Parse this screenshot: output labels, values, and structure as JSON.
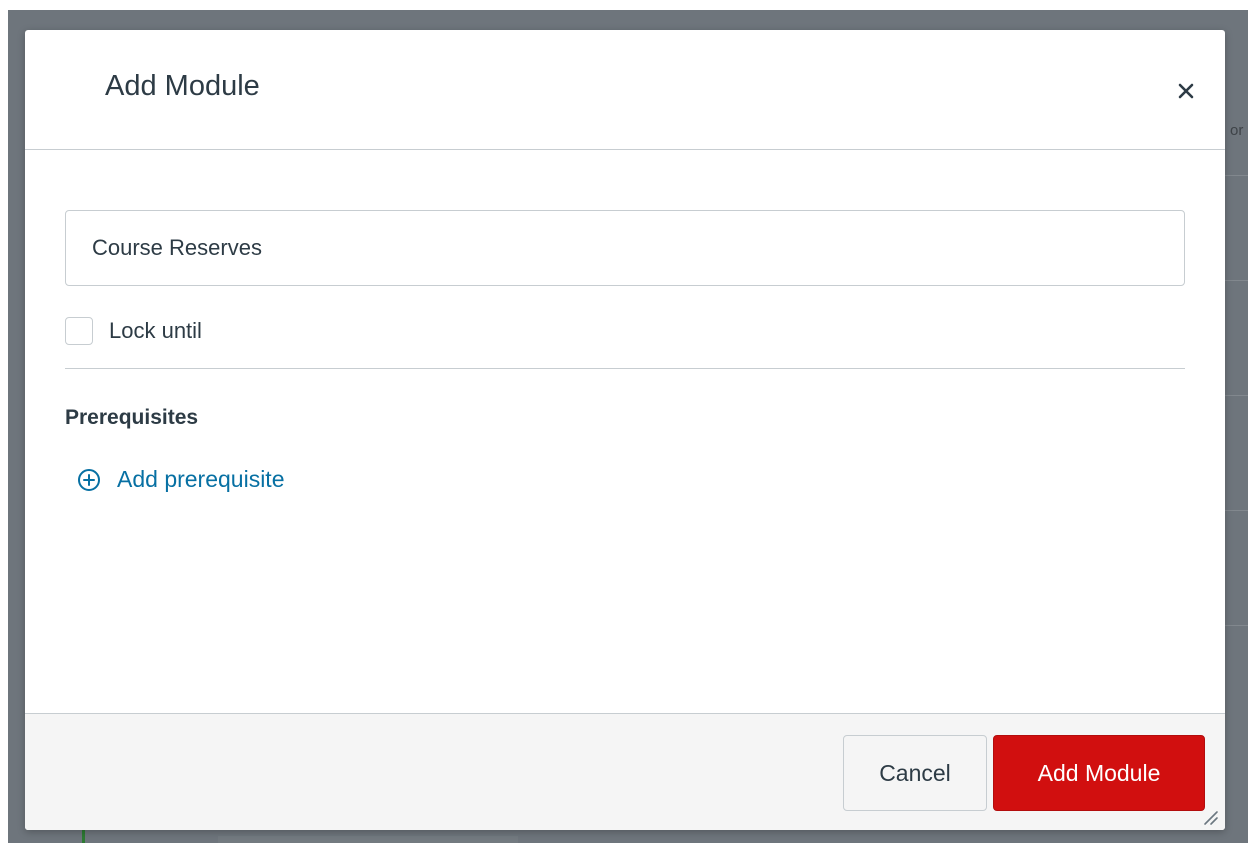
{
  "background": {
    "partial_text": "or"
  },
  "modal": {
    "title": "Add Module",
    "close_icon": "close-icon"
  },
  "form": {
    "module_name_value": "Course Reserves",
    "lock_until_label": "Lock until",
    "lock_until_checked": false,
    "prerequisites_heading": "Prerequisites",
    "add_prerequisite_label": "Add prerequisite",
    "add_prerequisite_icon": "plus-circle-icon"
  },
  "footer": {
    "cancel_label": "Cancel",
    "submit_label": "Add Module",
    "resize_icon": "resize-handle-icon"
  },
  "colors": {
    "primary_button": "#d10f0f",
    "link": "#0770a3",
    "text": "#2d3b45",
    "border": "#c7cdd1",
    "backdrop": "#6e757c"
  }
}
